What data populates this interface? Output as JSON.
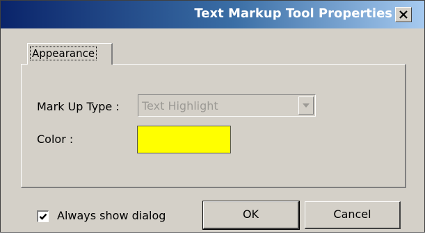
{
  "window": {
    "title": "Text Markup Tool Properties",
    "close_icon": "close-icon"
  },
  "tabs": [
    {
      "label": "Appearance",
      "selected": true
    }
  ],
  "form": {
    "markup_type_label": "Mark Up Type :",
    "markup_type_value": "Text Highlight",
    "markup_type_enabled": false,
    "color_label": "Color :",
    "color_value": "#ffff00"
  },
  "footer": {
    "always_show_label": "Always show dialog",
    "always_show_checked": true,
    "ok_label": "OK",
    "cancel_label": "Cancel"
  }
}
